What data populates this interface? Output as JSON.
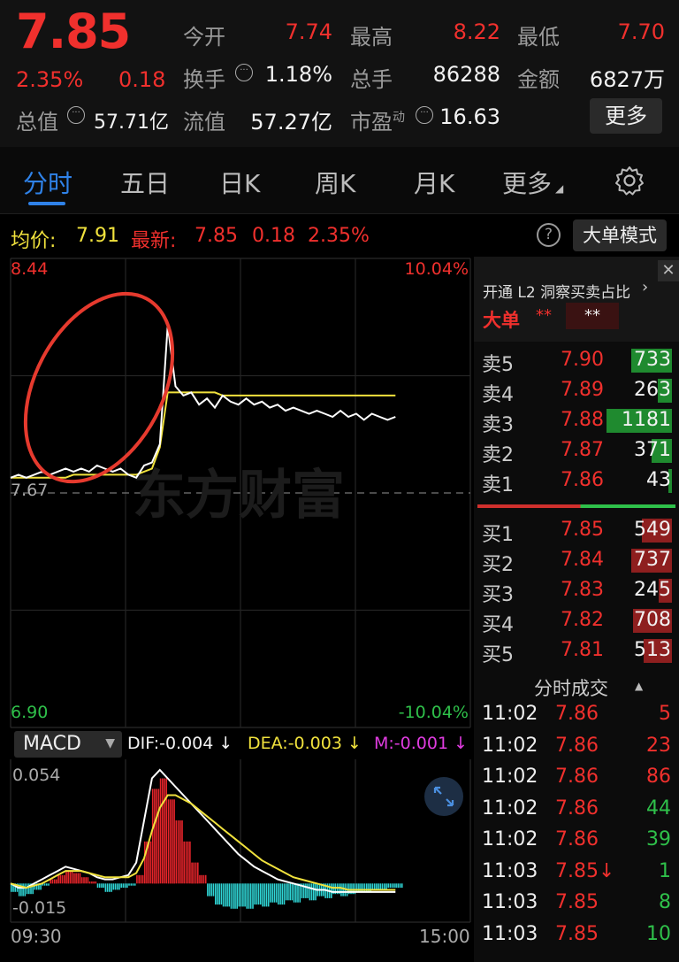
{
  "header": {
    "price": "7.85",
    "change_pct": "2.35%",
    "change": "0.18",
    "total_value_label": "总值",
    "total_value": "57.71亿",
    "fields": [
      {
        "label": "今开",
        "value": "7.74",
        "color": "red"
      },
      {
        "label": "最高",
        "value": "8.22",
        "color": "red"
      },
      {
        "label": "最低",
        "value": "7.70",
        "color": "red"
      },
      {
        "label": "换手",
        "value": "1.18%",
        "color": "white"
      },
      {
        "label": "总手",
        "value": "86288",
        "color": "white"
      },
      {
        "label": "金额",
        "value": "6827万",
        "color": "white"
      },
      {
        "label": "流值",
        "value": "57.27亿",
        "color": "white"
      },
      {
        "label": "市盈",
        "sup": "动",
        "value": "16.63",
        "color": "white"
      }
    ],
    "more": "更多"
  },
  "tabs": [
    "分时",
    "五日",
    "日K",
    "周K",
    "月K",
    "更多"
  ],
  "active_tab": 0,
  "info_line": {
    "avg_label": "均价:",
    "avg_value": "7.91",
    "latest_label": "最新:",
    "latest_value": "7.85",
    "latest_change": "0.18",
    "latest_pct": "2.35%",
    "help": "?",
    "big_mode": "大单模式"
  },
  "chart_data": [
    {
      "type": "line",
      "title": "",
      "y_top_label": "8.44",
      "y_bottom_label": "6.90",
      "y_mid_label": "7.67",
      "pct_top": "10.04%",
      "pct_bottom": "-10.04%",
      "ylim": [
        6.9,
        8.44
      ],
      "x_start": "09:30",
      "x_end": "15:00",
      "series": [
        {
          "name": "最新",
          "color": "#ffffff",
          "values": [
            7.72,
            7.73,
            7.72,
            7.73,
            7.74,
            7.73,
            7.74,
            7.75,
            7.74,
            7.75,
            7.74,
            7.76,
            7.75,
            7.74,
            7.75,
            7.73,
            7.72,
            7.76,
            7.77,
            7.83,
            8.22,
            8.02,
            7.99,
            8.0,
            7.96,
            7.98,
            7.95,
            7.99,
            7.97,
            7.96,
            7.98,
            7.96,
            7.97,
            7.95,
            7.96,
            7.94,
            7.95,
            7.94,
            7.93,
            7.94,
            7.93,
            7.92,
            7.94,
            7.92,
            7.93,
            7.91,
            7.93,
            7.92,
            7.91,
            7.92
          ]
        },
        {
          "name": "均价",
          "color": "#f1e23d",
          "values": [
            7.72,
            7.72,
            7.72,
            7.72,
            7.72,
            7.72,
            7.72,
            7.72,
            7.73,
            7.73,
            7.73,
            7.73,
            7.73,
            7.73,
            7.73,
            7.73,
            7.73,
            7.74,
            7.75,
            7.82,
            8.0,
            8.0,
            8.0,
            8.0,
            8.0,
            8.0,
            8.0,
            7.99,
            7.99,
            7.99,
            7.99,
            7.99,
            7.99,
            7.99,
            7.99,
            7.99,
            7.99,
            7.99,
            7.99,
            7.99,
            7.99,
            7.99,
            7.99,
            7.99,
            7.99,
            7.99,
            7.99,
            7.99,
            7.99,
            7.99
          ]
        }
      ]
    },
    {
      "type": "bar",
      "title": "MACD",
      "ylim": [
        -0.015,
        0.054
      ],
      "y_top_label": "0.054",
      "y_bottom_label": "-0.015",
      "indicators": {
        "dif": "DIF:-0.004",
        "dea": "DEA:-0.003",
        "m": "M:-0.001"
      },
      "bars": [
        -0.004,
        -0.006,
        -0.005,
        -0.003,
        -0.001,
        0.002,
        0.004,
        0.006,
        0.005,
        0.003,
        0.001,
        -0.002,
        -0.004,
        -0.003,
        -0.002,
        -0.001,
        0.004,
        0.02,
        0.045,
        0.05,
        0.04,
        0.03,
        0.02,
        0.01,
        0.004,
        -0.006,
        -0.01,
        -0.011,
        -0.012,
        -0.011,
        -0.012,
        -0.01,
        -0.011,
        -0.009,
        -0.01,
        -0.008,
        -0.009,
        -0.007,
        -0.008,
        -0.006,
        -0.007,
        -0.005,
        -0.006,
        -0.005,
        -0.004,
        -0.004,
        -0.003,
        -0.003,
        -0.002,
        -0.002
      ],
      "series": [
        {
          "name": "DIF",
          "color": "#ffffff",
          "values": [
            0.0,
            -0.002,
            -0.002,
            0.0,
            0.002,
            0.004,
            0.006,
            0.008,
            0.007,
            0.006,
            0.005,
            0.003,
            0.002,
            0.002,
            0.003,
            0.004,
            0.01,
            0.03,
            0.05,
            0.054,
            0.05,
            0.046,
            0.042,
            0.038,
            0.034,
            0.03,
            0.026,
            0.022,
            0.018,
            0.014,
            0.011,
            0.008,
            0.006,
            0.004,
            0.002,
            0.001,
            0.0,
            -0.001,
            -0.002,
            -0.003,
            -0.003,
            -0.004,
            -0.004,
            -0.004,
            -0.004,
            -0.004,
            -0.004,
            -0.004,
            -0.004,
            -0.004
          ]
        },
        {
          "name": "DEA",
          "color": "#f1e23d",
          "values": [
            0.0,
            -0.001,
            -0.002,
            -0.001,
            0.0,
            0.002,
            0.004,
            0.006,
            0.006,
            0.006,
            0.005,
            0.004,
            0.003,
            0.003,
            0.003,
            0.003,
            0.005,
            0.012,
            0.025,
            0.036,
            0.042,
            0.042,
            0.04,
            0.038,
            0.035,
            0.032,
            0.029,
            0.026,
            0.023,
            0.02,
            0.017,
            0.014,
            0.011,
            0.009,
            0.007,
            0.005,
            0.003,
            0.002,
            0.001,
            0.0,
            -0.001,
            -0.002,
            -0.002,
            -0.003,
            -0.003,
            -0.003,
            -0.003,
            -0.003,
            -0.003,
            -0.003
          ]
        }
      ]
    }
  ],
  "macd_select": "MACD",
  "watermark": "东方财富",
  "side": {
    "l2_label": "开通 L2 洞察买卖占比",
    "big_label": "大单",
    "stars": "**",
    "stars_box": "**",
    "asks": [
      {
        "label": "卖5",
        "price": "7.90",
        "vol": "733",
        "bar": 0.62
      },
      {
        "label": "卖4",
        "price": "7.89",
        "vol": "263",
        "bar": 0.22
      },
      {
        "label": "卖3",
        "price": "7.88",
        "vol": "1181",
        "bar": 1.0
      },
      {
        "label": "卖2",
        "price": "7.87",
        "vol": "371",
        "bar": 0.31
      },
      {
        "label": "卖1",
        "price": "7.86",
        "vol": "43",
        "bar": 0.04
      }
    ],
    "bids": [
      {
        "label": "买1",
        "price": "7.85",
        "vol": "549",
        "bar": 0.46
      },
      {
        "label": "买2",
        "price": "7.84",
        "vol": "737",
        "bar": 0.62
      },
      {
        "label": "买3",
        "price": "7.83",
        "vol": "245",
        "bar": 0.21
      },
      {
        "label": "买4",
        "price": "7.82",
        "vol": "708",
        "bar": 0.6
      },
      {
        "label": "买5",
        "price": "7.81",
        "vol": "513",
        "bar": 0.43
      }
    ],
    "trades_title": "分时成交",
    "trades": [
      {
        "time": "11:02",
        "price": "7.86",
        "vol": "5",
        "color": "red"
      },
      {
        "time": "11:02",
        "price": "7.86",
        "vol": "23",
        "color": "red"
      },
      {
        "time": "11:02",
        "price": "7.86",
        "vol": "86",
        "color": "red"
      },
      {
        "time": "11:02",
        "price": "7.86",
        "vol": "44",
        "color": "green"
      },
      {
        "time": "11:02",
        "price": "7.86",
        "vol": "39",
        "color": "green"
      },
      {
        "time": "11:03",
        "price": "7.85↓",
        "vol": "1",
        "color": "green"
      },
      {
        "time": "11:03",
        "price": "7.85",
        "vol": "8",
        "color": "green"
      },
      {
        "time": "11:03",
        "price": "7.85",
        "vol": "10",
        "color": "green"
      }
    ]
  }
}
